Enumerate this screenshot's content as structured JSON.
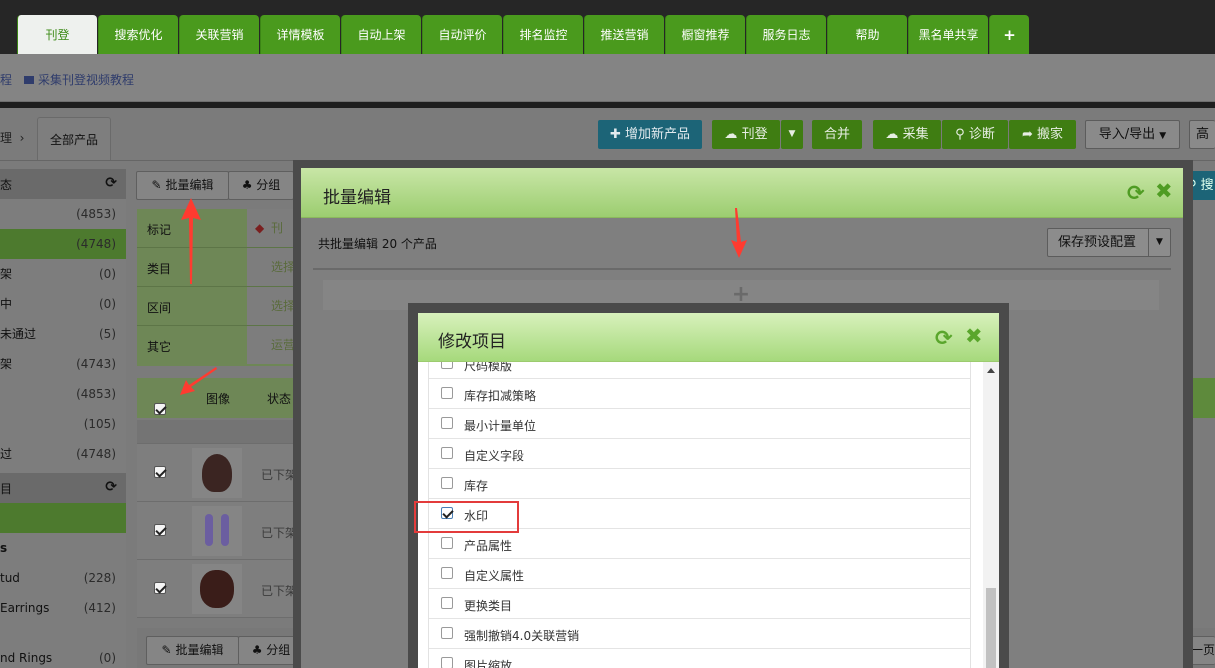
{
  "top_tabs": [
    {
      "label": "刊登",
      "active": true
    },
    {
      "label": "搜索优化"
    },
    {
      "label": "关联营销"
    },
    {
      "label": "详情模板"
    },
    {
      "label": "自动上架"
    },
    {
      "label": "自动评价"
    },
    {
      "label": "排名监控"
    },
    {
      "label": "推送营销"
    },
    {
      "label": "橱窗推荐"
    },
    {
      "label": "服务日志"
    },
    {
      "label": "帮助"
    },
    {
      "label": "黑名单共享"
    },
    {
      "label": "+"
    }
  ],
  "subbar": {
    "partial_link": "程",
    "video_tutorial": "采集刊登视频教程"
  },
  "breadcrumb": {
    "partial": "理",
    "separator": "›",
    "current": "全部产品"
  },
  "toolbar": {
    "add_product": "增加新产品",
    "publish": "刊登",
    "merge": "合并",
    "collect": "采集",
    "diagnose": "诊断",
    "move": "搬家",
    "import_export": "导入/导出",
    "advanced_partial": "高",
    "search_partial": "搜"
  },
  "left_panel": {
    "section1_partial": "态",
    "rows": [
      {
        "label": "",
        "count": "(4853)"
      },
      {
        "label": "",
        "count": "(4748)",
        "selected": true
      },
      {
        "label": "架",
        "count": "(0)"
      },
      {
        "label": "中",
        "count": "(0)"
      },
      {
        "label": "未通过",
        "count": "(5)"
      },
      {
        "label": "架",
        "count": "(4743)"
      },
      {
        "label": "",
        "count": "(4853)"
      },
      {
        "label": "",
        "count": "(105)"
      },
      {
        "label": "过",
        "count": "(4748)"
      }
    ],
    "section2_partial": "目",
    "rows2": [
      {
        "label": "s",
        "count": ""
      },
      {
        "label": "tud",
        "count": "(228)"
      },
      {
        "label": "Earrings",
        "count": "(412)"
      },
      {
        "label": "nd Rings",
        "count": "(0)"
      }
    ]
  },
  "list_toolbar": {
    "bulk_edit": "批量编辑",
    "group": "分组"
  },
  "filters": [
    {
      "label": "标记",
      "value": "刊"
    },
    {
      "label": "类目",
      "value": "选择"
    },
    {
      "label": "区间",
      "value": "选择"
    },
    {
      "label": "其它",
      "value": "运营"
    }
  ],
  "grid": {
    "col_image": "图像",
    "col_status": "状态",
    "rows": [
      {
        "status": "已下架"
      },
      {
        "status": "已下架"
      },
      {
        "status": "已下架"
      }
    ]
  },
  "bottom_toolbar": {
    "bulk_edit": "批量编辑",
    "group": "分组",
    "next_partial": "下一页"
  },
  "bulk_modal": {
    "title": "批量编辑",
    "summary": "共批量编辑 20 个产品",
    "save_preset": "保存预设配置"
  },
  "edit_items_modal": {
    "title": "修改项目",
    "items": [
      {
        "label": "尺码模版",
        "checked": false
      },
      {
        "label": "库存扣减策略",
        "checked": false
      },
      {
        "label": "最小计量单位",
        "checked": false
      },
      {
        "label": "自定义字段",
        "checked": false
      },
      {
        "label": "库存",
        "checked": false
      },
      {
        "label": "水印",
        "checked": true
      },
      {
        "label": "产品属性",
        "checked": false
      },
      {
        "label": "自定义属性",
        "checked": false
      },
      {
        "label": "更换类目",
        "checked": false
      },
      {
        "label": "强制撤销4.0关联营销",
        "checked": false
      },
      {
        "label": "图片缩放",
        "checked": false
      }
    ]
  },
  "colors": {
    "brand_green": "#4a9a1d",
    "header_green": "#a6d97c",
    "highlight_red": "#e33b3b",
    "arrow_red": "#ff3b30"
  }
}
